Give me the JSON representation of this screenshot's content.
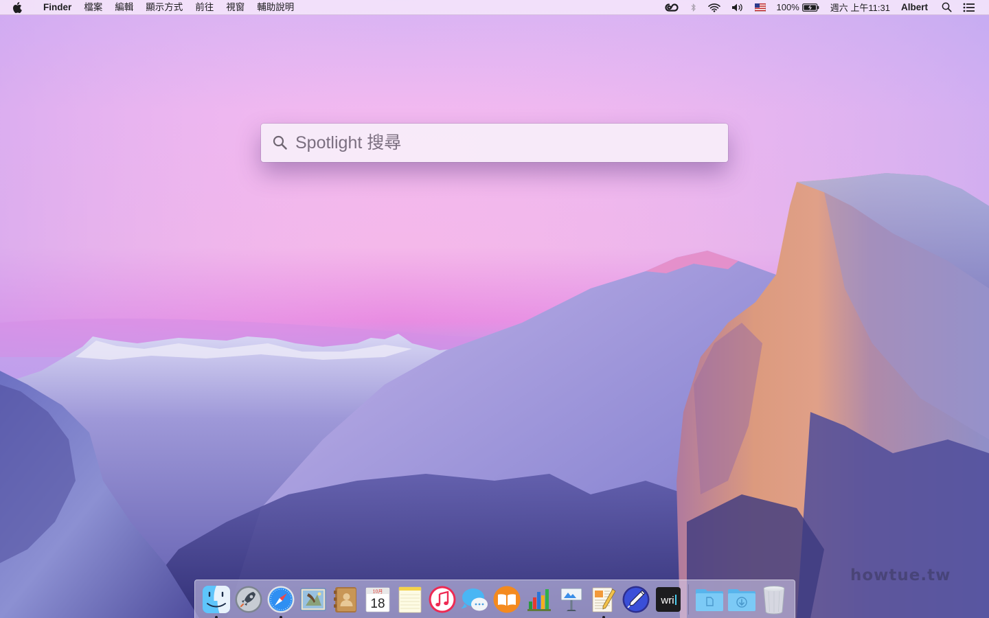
{
  "menubar": {
    "app_name": "Finder",
    "menus": [
      "檔案",
      "編輯",
      "顯示方式",
      "前往",
      "視窗",
      "輔助說明"
    ],
    "icons": [
      "apple-icon",
      "creative-cloud-icon",
      "bluetooth-icon",
      "wifi-icon",
      "volume-icon",
      "us-flag-icon",
      "battery-icon",
      "spotlight-icon",
      "notification-center-icon"
    ],
    "battery": "100%",
    "datetime": "週六 上午11:31",
    "user": "Albert"
  },
  "spotlight": {
    "placeholder": "Spotlight 搜尋"
  },
  "calendar_icon": {
    "month": "10月",
    "day": "18"
  },
  "writer_icon": {
    "label": "wri"
  },
  "dock": {
    "apps": [
      "finder-icon",
      "launchpad-icon",
      "safari-icon",
      "mail-icon",
      "contacts-icon",
      "calendar-icon",
      "notes-icon",
      "itunes-icon",
      "messages-icon",
      "ibooks-icon",
      "numbers-icon",
      "keynote-icon",
      "pages-icon",
      "pencil-app-icon",
      "writer-app-icon"
    ],
    "running": [
      "finder-icon",
      "safari-icon",
      "pages-icon"
    ],
    "folders": [
      "documents-folder-icon",
      "downloads-folder-icon",
      "trash-icon"
    ]
  },
  "watermark": "howtue.tw",
  "colors": {
    "sky_top": "#ddb2f4",
    "sky_pink": "#f3b7ec",
    "mountain_blue": "#5a5ab0",
    "rock_orange": "#d9987e"
  }
}
